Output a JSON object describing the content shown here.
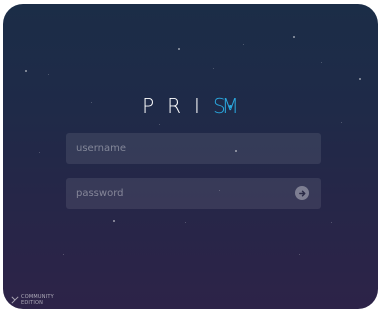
{
  "app": {
    "logo_letters": [
      "P",
      "R",
      "I",
      "S",
      "M"
    ],
    "accent_color": "#2aa9e0"
  },
  "login": {
    "username_placeholder": "username",
    "password_placeholder": "password",
    "submit_icon": "arrow-right-icon"
  },
  "footer": {
    "edition_line1": "COMMUNITY",
    "edition_line2": "EDITION"
  }
}
